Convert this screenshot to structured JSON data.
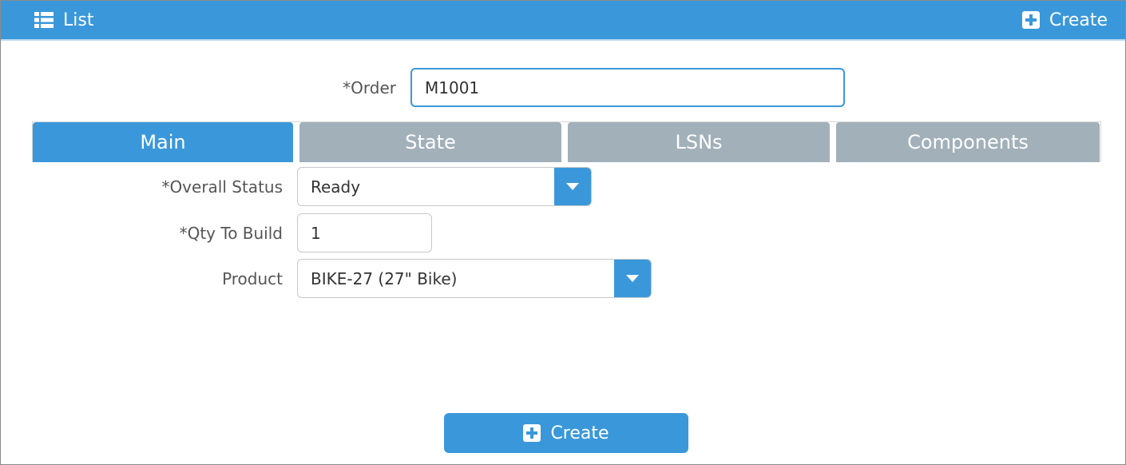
{
  "header": {
    "list_label": "List",
    "create_label": "Create",
    "list_icon": "list-icon",
    "create_icon": "plus-square-icon"
  },
  "form": {
    "order": {
      "label": "*Order",
      "value": "M1001"
    },
    "tabs": [
      {
        "label": "Main",
        "active": true
      },
      {
        "label": "State",
        "active": false
      },
      {
        "label": "LSNs",
        "active": false
      },
      {
        "label": "Components",
        "active": false
      }
    ],
    "overall_status": {
      "label": "*Overall Status",
      "value": "Ready"
    },
    "qty_to_build": {
      "label": "*Qty To Build",
      "value": "1"
    },
    "product": {
      "label": "Product",
      "value": "BIKE-27 (27\" Bike)"
    }
  },
  "footer": {
    "create_label": "Create"
  },
  "colors": {
    "accent": "#3a98da",
    "tab_inactive": "#a2b0ba",
    "label_text": "#555555"
  }
}
